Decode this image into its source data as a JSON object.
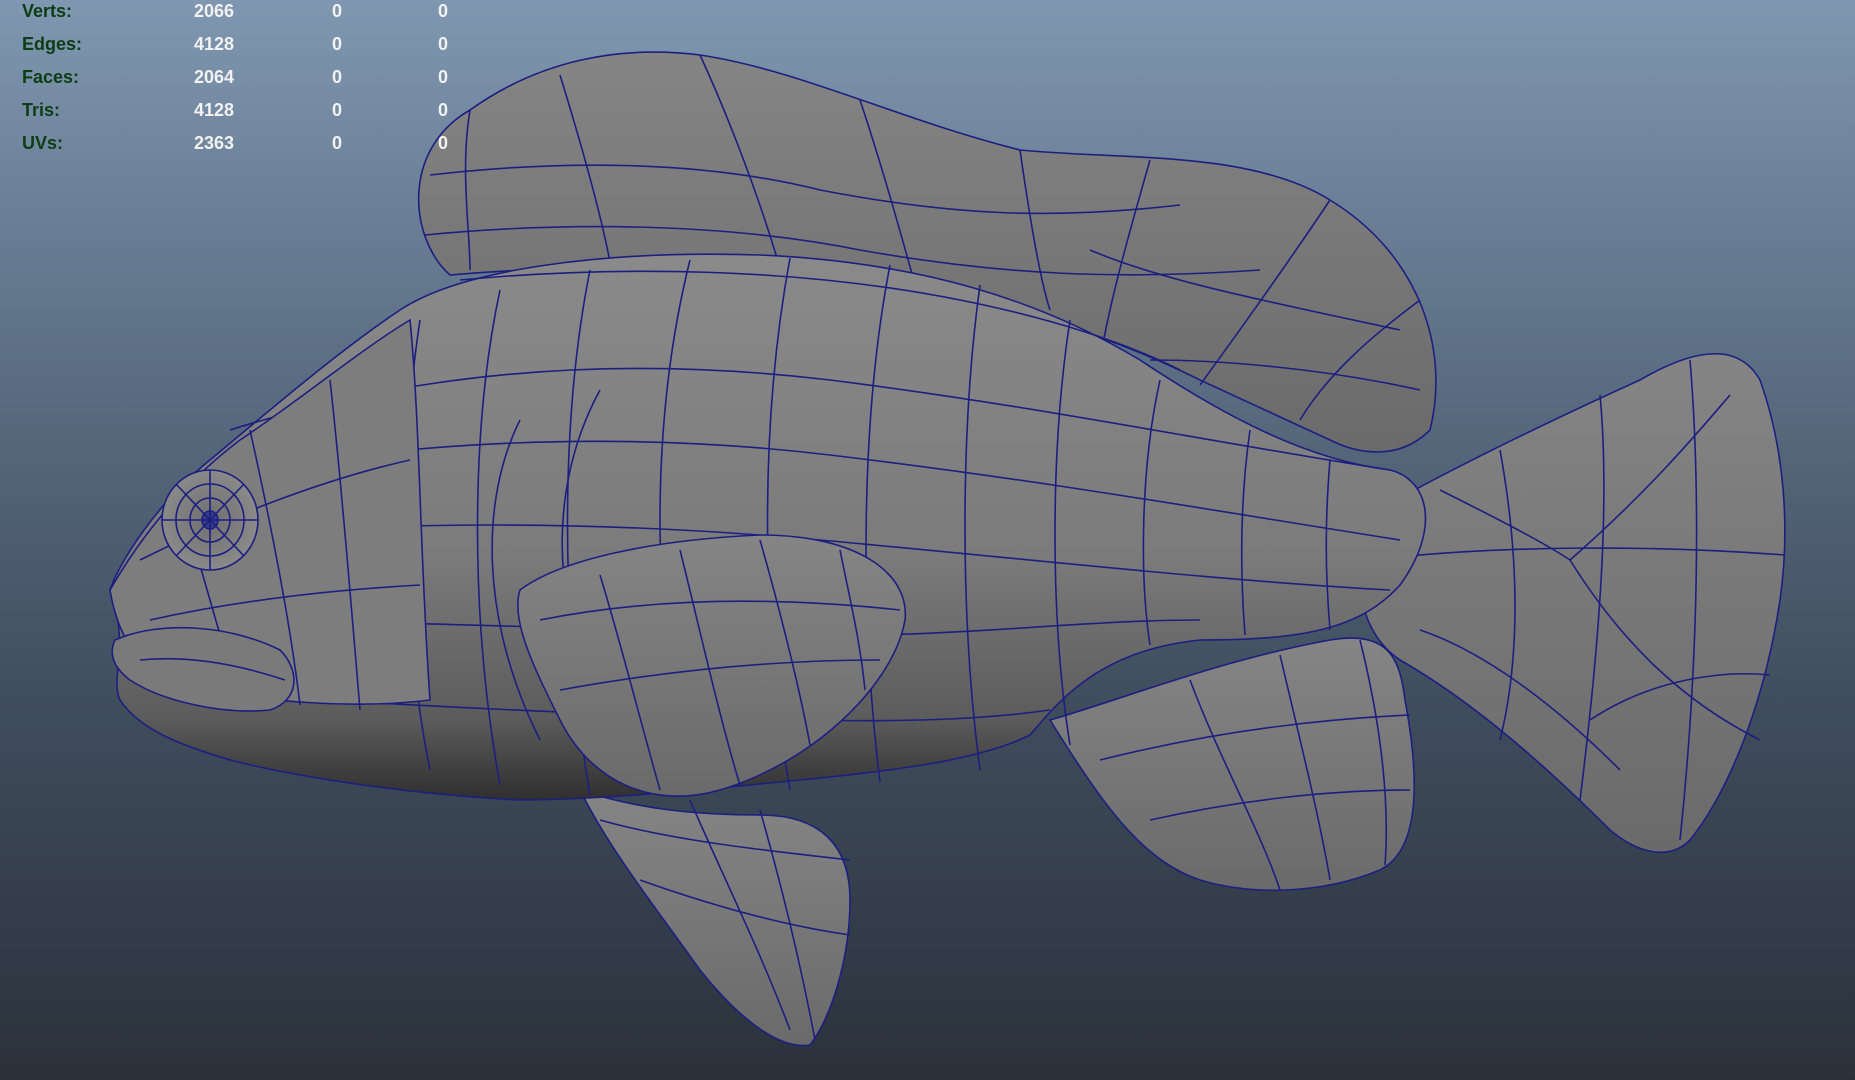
{
  "app": {
    "view": "3D viewport",
    "model": "fish mesh (wireframe on shaded)"
  },
  "poly_count": {
    "rows": [
      {
        "label": "Verts:",
        "values": [
          "2066",
          "0",
          "0"
        ]
      },
      {
        "label": "Edges:",
        "values": [
          "4128",
          "0",
          "0"
        ]
      },
      {
        "label": "Faces:",
        "values": [
          "2064",
          "0",
          "0"
        ]
      },
      {
        "label": "Tris:",
        "values": [
          "4128",
          "0",
          "0"
        ]
      },
      {
        "label": "UVs:",
        "values": [
          "2363",
          "0",
          "0"
        ]
      }
    ]
  },
  "colors": {
    "bg_top": "#7f97b0",
    "bg_bottom": "#2a313b",
    "hud_label": "#0c3d14",
    "hud_value": "#f2f2f2",
    "mesh_fill": "#7a7a7a",
    "wire": "#1c1f80"
  }
}
